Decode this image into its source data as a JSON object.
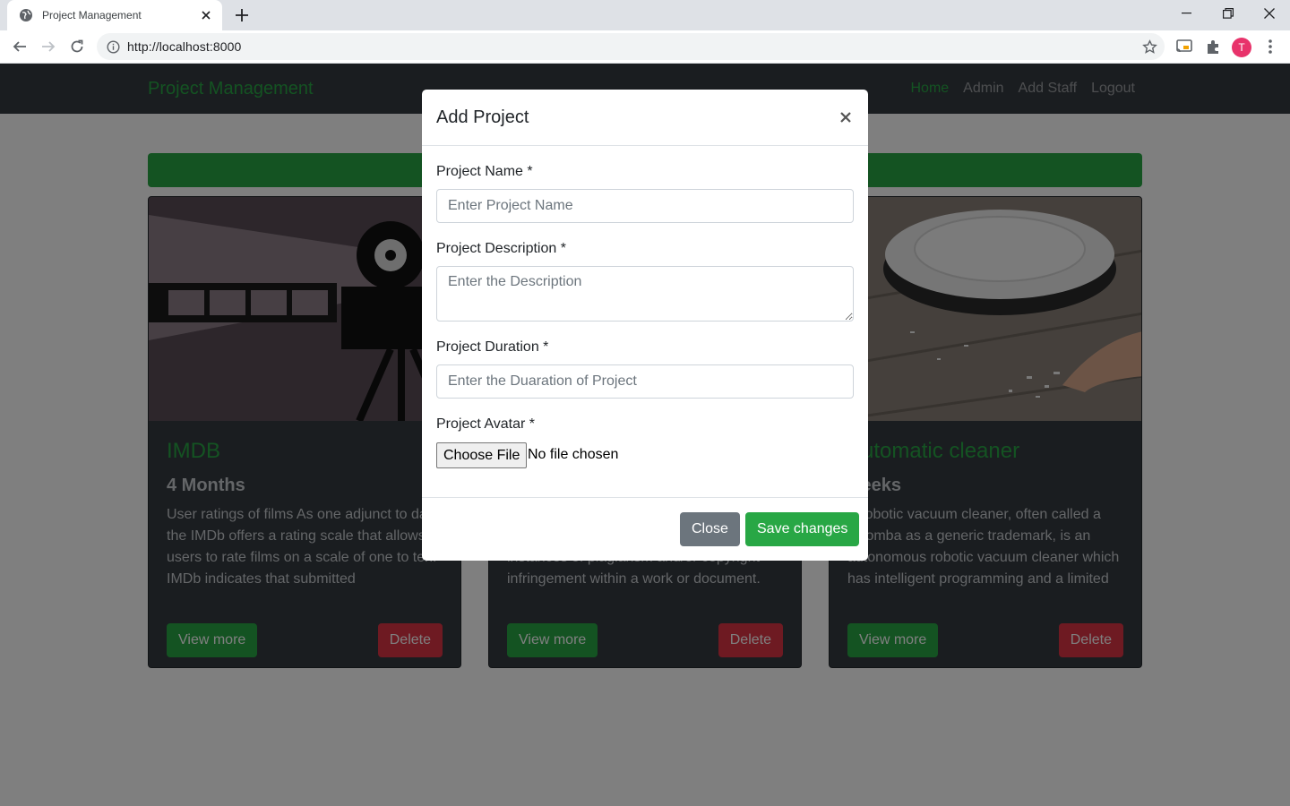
{
  "browser": {
    "tab_title": "Project Management",
    "url": "http://localhost:8000",
    "profile_initial": "T"
  },
  "nav": {
    "brand": "Project Management",
    "links": [
      "Home",
      "Admin",
      "Add Staff",
      "Logout"
    ],
    "active": "Home"
  },
  "cards": [
    {
      "title": "IMDB",
      "duration": "4 Months",
      "description": "User ratings of films As one adjunct to data, the IMDb offers a rating scale that allows users to rate films on a scale of one to ten. IMDb indicates that submitted",
      "view_label": "View more",
      "delete_label": "Delete"
    },
    {
      "title": "",
      "duration": "",
      "description": "instances of plagiarism and/or copyright infringement within a work or document.",
      "view_label": "View more",
      "delete_label": "Delete"
    },
    {
      "title": "Automatic cleaner",
      "duration": "weeks",
      "description": "A robotic vacuum cleaner, often called a Roomba as a generic trademark, is an autonomous robotic vacuum cleaner which has intelligent programming and a limited",
      "view_label": "View more",
      "delete_label": "Delete"
    }
  ],
  "modal": {
    "title": "Add Project",
    "fields": {
      "name": {
        "label": "Project Name *",
        "placeholder": "Enter Project Name"
      },
      "description": {
        "label": "Project Description *",
        "placeholder": "Enter the Description"
      },
      "duration": {
        "label": "Project Duration *",
        "placeholder": "Enter the Duaration of Project"
      },
      "avatar": {
        "label": "Project Avatar *",
        "button": "Choose File",
        "status": "No file chosen"
      }
    },
    "close_label": "Close",
    "save_label": "Save changes"
  },
  "colors": {
    "accent": "#28a745",
    "danger": "#dc3545",
    "secondary": "#6c757d",
    "navbar": "#343a40"
  }
}
